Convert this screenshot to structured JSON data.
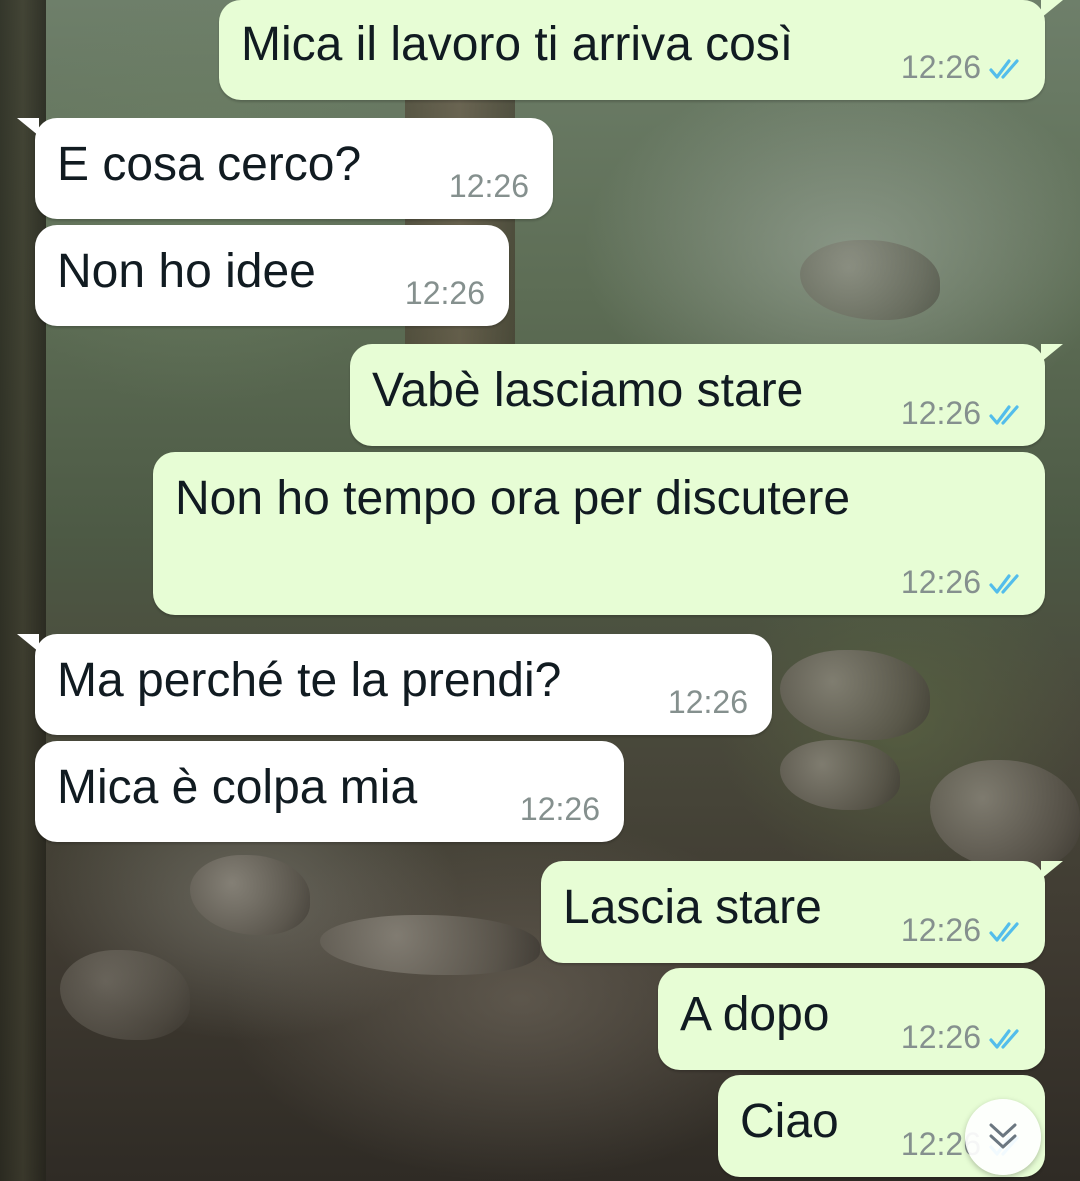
{
  "colors": {
    "outgoing_bubble": "#e7fdd5",
    "incoming_bubble": "#ffffff",
    "read_ticks": "#53bdeb",
    "timestamp": "#85908e",
    "text": "#111b21"
  },
  "wallpaper": {
    "description_icon": "forest-creek-wallpaper"
  },
  "messages": [
    {
      "direction": "out",
      "text": "Mica il lavoro ti arriva così",
      "time": "12:26",
      "status": "read"
    },
    {
      "direction": "in",
      "text": "E cosa cerco?",
      "time": "12:26"
    },
    {
      "direction": "in",
      "text": "Non ho idee",
      "time": "12:26"
    },
    {
      "direction": "out",
      "text": "Vabè lasciamo stare",
      "time": "12:26",
      "status": "read"
    },
    {
      "direction": "out",
      "text": "Non ho tempo ora per discutere",
      "time": "12:26",
      "status": "read"
    },
    {
      "direction": "in",
      "text": "Ma perché te la prendi?",
      "time": "12:26"
    },
    {
      "direction": "in",
      "text": "Mica è colpa mia",
      "time": "12:26"
    },
    {
      "direction": "out",
      "text": "Lascia stare",
      "time": "12:26",
      "status": "read"
    },
    {
      "direction": "out",
      "text": "A dopo",
      "time": "12:26",
      "status": "read"
    },
    {
      "direction": "out",
      "text": "Ciao",
      "time": "12:26",
      "status": "read"
    }
  ],
  "scroll_button": {
    "icon": "double-chevron-down-icon"
  }
}
